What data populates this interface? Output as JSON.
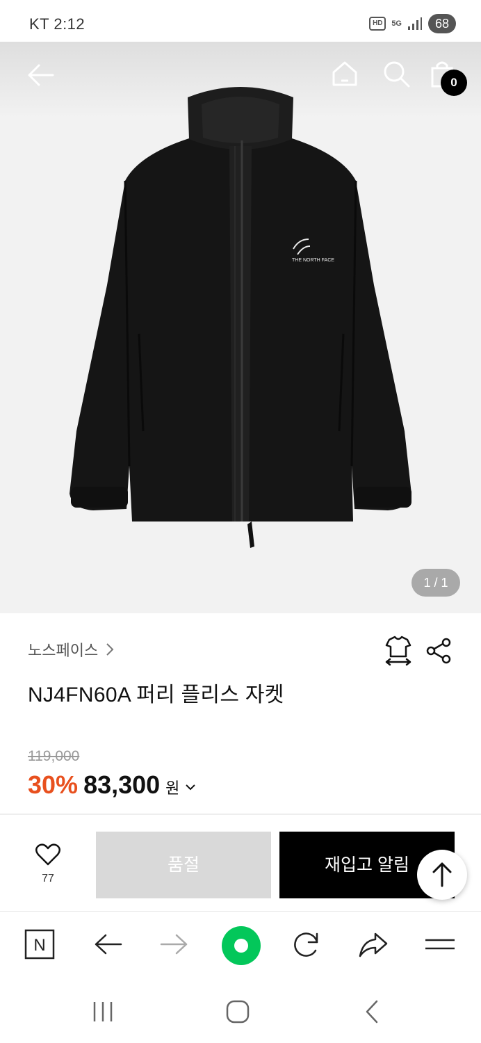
{
  "status_bar": {
    "carrier": "KT 2:12",
    "network_hd": "HD",
    "network_5g": "5G",
    "battery": "68",
    "icons": [
      "hd-icon",
      "5g-icon",
      "signal-icon",
      "battery-icon"
    ]
  },
  "product_nav": {
    "cart_count": "0",
    "icons": [
      "back-arrow-icon",
      "home-icon",
      "search-icon",
      "shopping-bag-icon"
    ]
  },
  "gallery": {
    "pager": "1 / 1",
    "image": "black-fleece-jacket",
    "logo_text": "THE NORTH FACE"
  },
  "product": {
    "brand": "노스페이스",
    "title": "NJ4FN60A 퍼리 플리스 자켓",
    "original_price": "119,000",
    "discount": "30%",
    "sale_price": "83,300",
    "currency": "원"
  },
  "actions": {
    "like_count": "77",
    "soldout_label": "품절",
    "restock_label": "재입고 알림"
  },
  "browser_toolbar": {
    "n_label": "N",
    "items": [
      "naver-n-icon",
      "back-arrow-icon",
      "forward-arrow-icon",
      "green-dot-icon",
      "refresh-icon",
      "share-arrow-icon",
      "menu-icon"
    ]
  },
  "android_nav": {
    "items": [
      "recent-apps-icon",
      "home-button-icon",
      "back-icon"
    ]
  },
  "colors": {
    "accent_discount": "#e8501e",
    "primary_button": "#000000",
    "disabled_button": "#d9d9d9",
    "naver_green": "#03c75a"
  }
}
